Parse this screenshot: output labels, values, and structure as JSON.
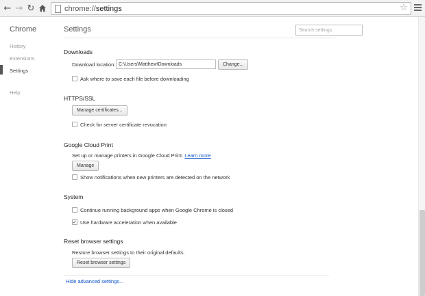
{
  "toolbar": {
    "back_icon": "arrow-left-icon",
    "forward_icon": "arrow-right-icon",
    "reload_icon": "reload-icon",
    "home_icon": "home-icon",
    "url_scheme": "chrome://",
    "url_host": "settings",
    "star_icon": "star-icon",
    "menu_icon": "hamburger-menu-icon"
  },
  "sidebar": {
    "brand": "Chrome",
    "items": [
      {
        "label": "History"
      },
      {
        "label": "Extensions"
      },
      {
        "label": "Settings",
        "selected": true
      },
      {
        "label": "Help"
      }
    ]
  },
  "main": {
    "title": "Settings",
    "search_placeholder": "Search settings",
    "downloads": {
      "title": "Downloads",
      "location_label": "Download location:",
      "location_value": "C:\\Users\\Matthew\\Downloads",
      "change_button": "Change...",
      "ask_checkbox_label": "Ask where to save each file before downloading",
      "ask_checked": false
    },
    "https": {
      "title": "HTTPS/SSL",
      "manage_button": "Manage certificates...",
      "revocation_label": "Check for server certificate revocation",
      "revocation_checked": false
    },
    "cloud_print": {
      "title": "Google Cloud Print",
      "description": "Set up or manage printers in Google Cloud Print.",
      "learn_more": "Learn more",
      "manage_button": "Manage",
      "notify_label": "Show notifications when new printers are detected on the network",
      "notify_checked": false
    },
    "system": {
      "title": "System",
      "background_label": "Continue running background apps when Google Chrome is closed",
      "background_checked": false,
      "hw_accel_label": "Use hardware acceleration when available",
      "hw_accel_checked": true
    },
    "reset": {
      "title": "Reset browser settings",
      "description": "Restore browser settings to their original defaults.",
      "reset_button": "Reset browser settings"
    },
    "hide_advanced": "Hide advanced settings..."
  },
  "colors": {
    "link": "#1155cc",
    "toolbar_bg": "#f2f2f2"
  }
}
